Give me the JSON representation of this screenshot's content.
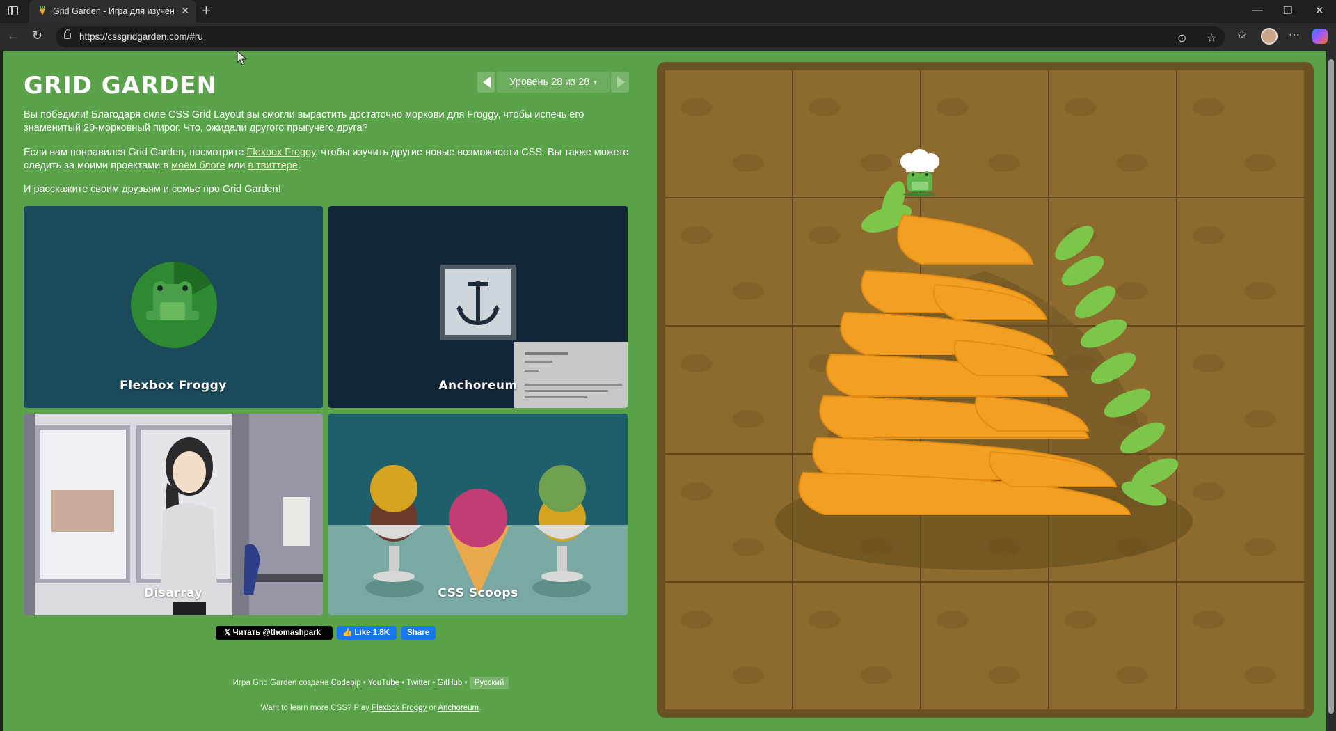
{
  "browser": {
    "tab_title": "Grid Garden - Игра для изучения",
    "tab_close": "✕",
    "new_tab": "+",
    "url": "https://cssgridgarden.com/#ru",
    "window_controls": [
      "—",
      "❐",
      "✕"
    ]
  },
  "header": {
    "logo": "GRID GARDEN",
    "level_text": "Уровень 28 из 28",
    "level_caret": "▾"
  },
  "intro": {
    "p1": "Вы победили! Благодаря силе CSS Grid Layout вы смогли вырастить достаточно моркови для Froggy, чтобы испечь его знаменитый 20-морковный пирог. Что, ожидали другого прыгучего друга?",
    "p2_before": "Если вам понравился Grid Garden, посмотрите ",
    "p2_link1": "Flexbox Froggy",
    "p2_middle": ", чтобы изучить другие новые возможности CSS. Вы также можете следить за моими проектами в ",
    "p2_link2": "моём блоге",
    "p2_or": " или ",
    "p2_link3": "в твиттере",
    "p2_end": ".",
    "p3": "И расскажите своим друзьям и семье про Grid Garden!"
  },
  "tiles": [
    {
      "label": "Flexbox Froggy",
      "bg": "#1b4b5a",
      "icon": "frog-icon"
    },
    {
      "label": "Anchoreum",
      "bg": "#132638",
      "icon": "anchor-icon"
    },
    {
      "label": "Disarray",
      "bg": "#8f8fa0",
      "icon": "girl-illustration"
    },
    {
      "label": "CSS Scoops",
      "bg": "#1f5f6b",
      "icon": "ice-cream-icon"
    }
  ],
  "social": {
    "x_follow": "Читать @thomashpark",
    "fb_like": "Like 1.8K",
    "fb_share": "Share"
  },
  "footer": {
    "line1_prefix": "Игра Grid Garden создана ",
    "links": [
      "Codepip",
      "YouTube",
      "Twitter",
      "GitHub"
    ],
    "separator": " • ",
    "language": "Русский",
    "line2_prefix": "Want to learn more CSS? Play ",
    "line2_link1": "Flexbox Froggy",
    "line2_or": " or ",
    "line2_link2": "Anchoreum",
    "line2_end": "."
  },
  "colors": {
    "page_bg": "#5aa34b",
    "soil": "#8d6a2e",
    "carrot": "#f2a024",
    "leaf": "#7cc64a"
  }
}
